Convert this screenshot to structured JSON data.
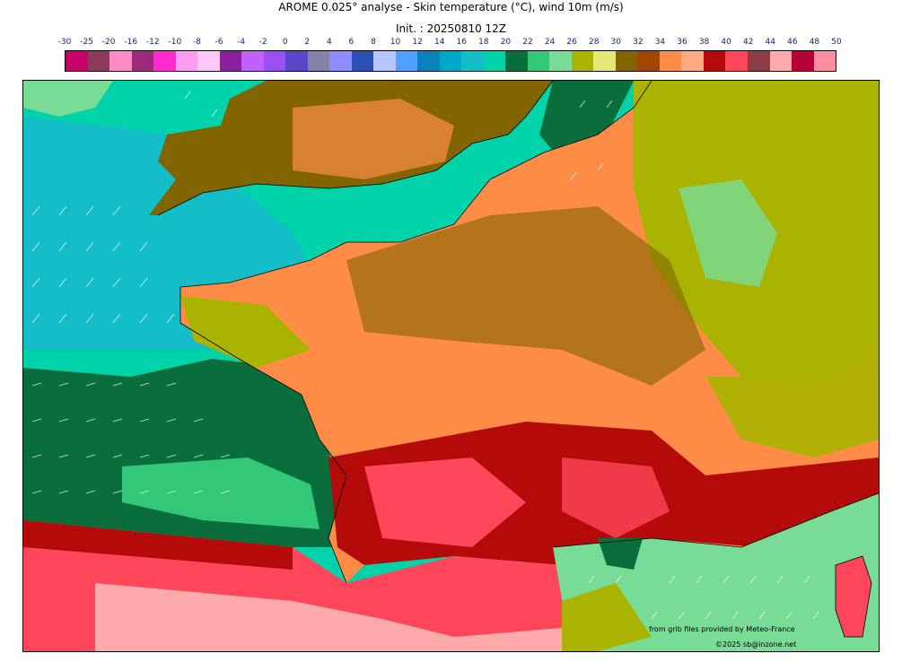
{
  "title": "AROME 0.025° analyse - Skin temperature (°C), wind 10m (m/s)",
  "init": "Init. : 20250810 12Z",
  "scale": {
    "labels": [
      "-30",
      "-25",
      "-20",
      "-16",
      "-12",
      "-10",
      "-8",
      "-6",
      "-4",
      "-2",
      "0",
      "2",
      "4",
      "6",
      "8",
      "10",
      "12",
      "14",
      "16",
      "18",
      "20",
      "22",
      "24",
      "26",
      "28",
      "30",
      "32",
      "34",
      "36",
      "38",
      "40",
      "42",
      "44",
      "46",
      "48",
      "50"
    ],
    "colors": [
      "#c8006a",
      "#8c3c5a",
      "#ff8cc8",
      "#9e2a7e",
      "#ff2ad0",
      "#ff9cf0",
      "#ffc8f8",
      "#8c1ea0",
      "#c060ff",
      "#9a50f0",
      "#5a46c8",
      "#8484a8",
      "#8c8cff",
      "#2d50b4",
      "#b4c8ff",
      "#50a0ff",
      "#0a82be",
      "#00a8c8",
      "#14bec8",
      "#00d2aa",
      "#0a6e3c",
      "#32c878",
      "#78dc96",
      "#aab400",
      "#e6e678",
      "#826400",
      "#a04600",
      "#ff8c46",
      "#ffaa82",
      "#b40a0a",
      "#ff465a",
      "#8c3c46",
      "#ffaaaa",
      "#b40036",
      "#ff8ca0"
    ]
  },
  "map_regions": {
    "sea_north": "#00d2aa",
    "sea_west": "#14bec8",
    "sea_dark": "#0a6e3c",
    "med_sea": "#78dc96",
    "land_warm": "#826400",
    "land_hot": "#ff8c46",
    "land_very_hot": "#b40a0a",
    "land_extreme": "#ff465a",
    "land_cool": "#aab400"
  },
  "credit": {
    "line1": "from grib files provided by Meteo-France",
    "line2": "©2025 sb@inzone.net"
  }
}
